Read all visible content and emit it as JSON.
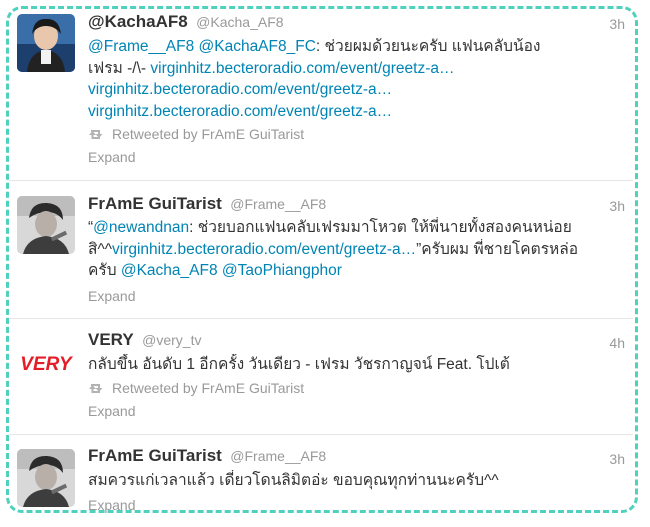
{
  "colors": {
    "link": "#0084b4",
    "name": "#333333",
    "muted": "#999999",
    "frame_border": "#4fd1bd",
    "very_logo": "#e41e26"
  },
  "tweets": [
    {
      "avatar_icon": "user-photo-kacha",
      "name": "@KachaAF8",
      "handle": "@Kacha_AF8",
      "time": "3h",
      "lines": [
        [
          {
            "t": "@Frame__AF8",
            "link": true
          },
          {
            "t": " ",
            "link": false
          },
          {
            "t": "@KachaAF8_FC",
            "link": true
          },
          {
            "t": ": ช่วยผมด้วยนะครับ แฟนคลับน้อง",
            "link": false
          }
        ],
        [
          {
            "t": "เฟรม -/\\- ",
            "link": false
          },
          {
            "t": "virginhitz.becteroradio.com/event/greetz-a…",
            "link": true
          }
        ],
        [
          {
            "t": "virginhitz.becteroradio.com/event/greetz-a…",
            "link": true
          }
        ],
        [
          {
            "t": "virginhitz.becteroradio.com/event/greetz-a…",
            "link": true
          }
        ]
      ],
      "retweeted_by": "Retweeted by FrAmE GuiTarist",
      "expand": "Expand"
    },
    {
      "avatar_icon": "user-photo-frame",
      "name": "FrAmE GuiTarist",
      "handle": "@Frame__AF8",
      "time": "3h",
      "lines": [
        [
          {
            "t": "“",
            "link": false
          },
          {
            "t": "@newandnan",
            "link": true
          },
          {
            "t": ": ช่วยบอกแฟนคลับเฟรมมาโหวต ให้พี่นายทั้งสองคนหน่อย",
            "link": false
          }
        ],
        [
          {
            "t": "สิ^^",
            "link": false
          },
          {
            "t": "virginhitz.becteroradio.com/event/greetz-a…",
            "link": true
          },
          {
            "t": "”ครับผม พี่ชายโคตรหล่อ",
            "link": false
          }
        ],
        [
          {
            "t": "ครับ ",
            "link": false
          },
          {
            "t": "@Kacha_AF8",
            "link": true
          },
          {
            "t": " ",
            "link": false
          },
          {
            "t": "@TaoPhiangphor",
            "link": true
          }
        ]
      ],
      "retweeted_by": "",
      "expand": "Expand"
    },
    {
      "avatar_icon": "very-logo",
      "avatar_text": "VERY",
      "name": "VERY",
      "handle": "@very_tv",
      "time": "4h",
      "lines": [
        [
          {
            "t": "กลับขึ้น อันดับ 1 อีกครั้ง วันเดียว - เฟรม วัชรกาญจน์ Feat. โปเต้",
            "link": false
          }
        ]
      ],
      "retweeted_by": "Retweeted by FrAmE GuiTarist",
      "expand": "Expand"
    },
    {
      "avatar_icon": "user-photo-frame",
      "name": "FrAmE GuiTarist",
      "handle": "@Frame__AF8",
      "time": "3h",
      "lines": [
        [
          {
            "t": "สมควรแก่เวลาแล้ว เดี๋ยวโดนลิมิตอ่ะ ขอบคุณทุกท่านนะครับ^^",
            "link": false
          }
        ]
      ],
      "retweeted_by": "",
      "expand": "Expand"
    }
  ]
}
